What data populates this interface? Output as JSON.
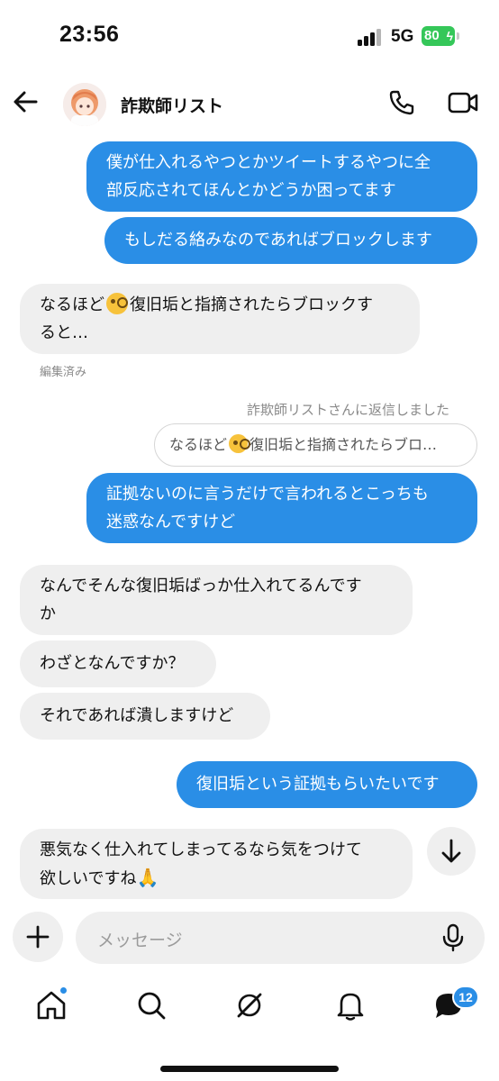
{
  "status_bar": {
    "time": "23:56",
    "network": "5G",
    "battery": "80"
  },
  "header": {
    "title": "詐欺師リスト",
    "back_icon": "arrow-left-icon",
    "call_icon": "phone-icon",
    "video_icon": "video-icon"
  },
  "messages": {
    "m1": "僕が仕入れるやつとかツイートするやつに全\n部反応されてほんとかどうか困ってます",
    "m2": "もしだる絡みなのであればブロックします",
    "m3_a": "なるほど",
    "m3_b": "復旧垢と指摘されたらブロックす\nると…",
    "m3_edited": "編集済み",
    "reply_note": "詐欺師リストさんに返信しました",
    "reply_quote_a": "なるほど",
    "reply_quote_b": "復旧垢と指摘されたらブロ…",
    "m4": "証拠ないのに言うだけで言われるとこっちも\n迷惑なんですけど",
    "m5": "なんでそんな復旧垢ばっか仕入れてるんです\nか",
    "m6": "わざとなんですか？",
    "m7": "それであれば潰しますけど",
    "m8": "復旧垢という証拠もらいたいです",
    "m9": "悪気なく仕入れてしまってるなら気をつけて\n欲しいですね"
  },
  "composer": {
    "placeholder": "メッセージ"
  },
  "tab_bar": {
    "badge": "12"
  },
  "colors": {
    "accent": "#2a8ee6",
    "incoming_bubble": "#efefef",
    "battery": "#35c759"
  }
}
